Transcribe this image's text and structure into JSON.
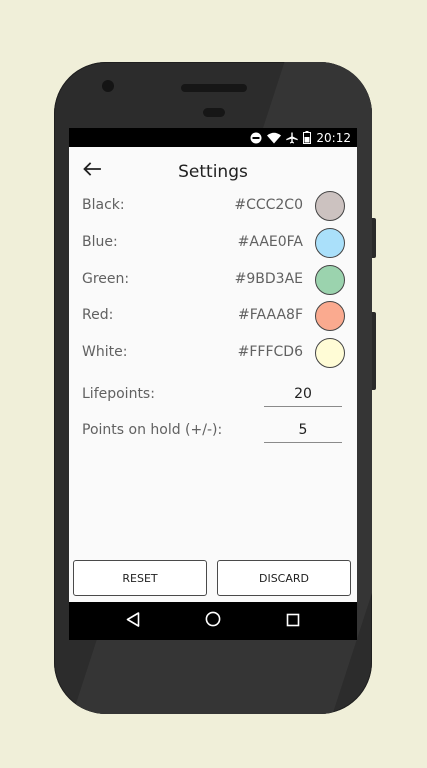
{
  "status_bar": {
    "time": "20:12",
    "icons": [
      "do-not-disturb-icon",
      "wifi-icon",
      "airplane-icon",
      "battery-icon"
    ]
  },
  "toolbar": {
    "title": "Settings",
    "back_icon": "arrow-back-icon"
  },
  "colors": [
    {
      "label": "Black:",
      "hex": "#CCC2C0",
      "swatch": "#CCC2C0"
    },
    {
      "label": "Blue:",
      "hex": "#AAE0FA",
      "swatch": "#AAE0FA"
    },
    {
      "label": "Green:",
      "hex": "#9BD3AE",
      "swatch": "#9BD3AE"
    },
    {
      "label": "Red:",
      "hex": "#FAAA8F",
      "swatch": "#FAAA8F"
    },
    {
      "label": "White:",
      "hex": "#FFFCD6",
      "swatch": "#FFFCD6"
    }
  ],
  "fields": {
    "lifepoints": {
      "label": "Lifepoints:",
      "value": "20"
    },
    "points_on_hold": {
      "label": "Points on hold (+/-):",
      "value": "5"
    }
  },
  "buttons": {
    "reset": "RESET",
    "discard": "DISCARD"
  },
  "navbar": {
    "icons": [
      "nav-back-icon",
      "nav-home-icon",
      "nav-recents-icon"
    ]
  },
  "theme": {
    "background": "#f0efd9",
    "phone_body": "#2c2c2c",
    "screen": "#fafafa",
    "text": "#616161"
  }
}
